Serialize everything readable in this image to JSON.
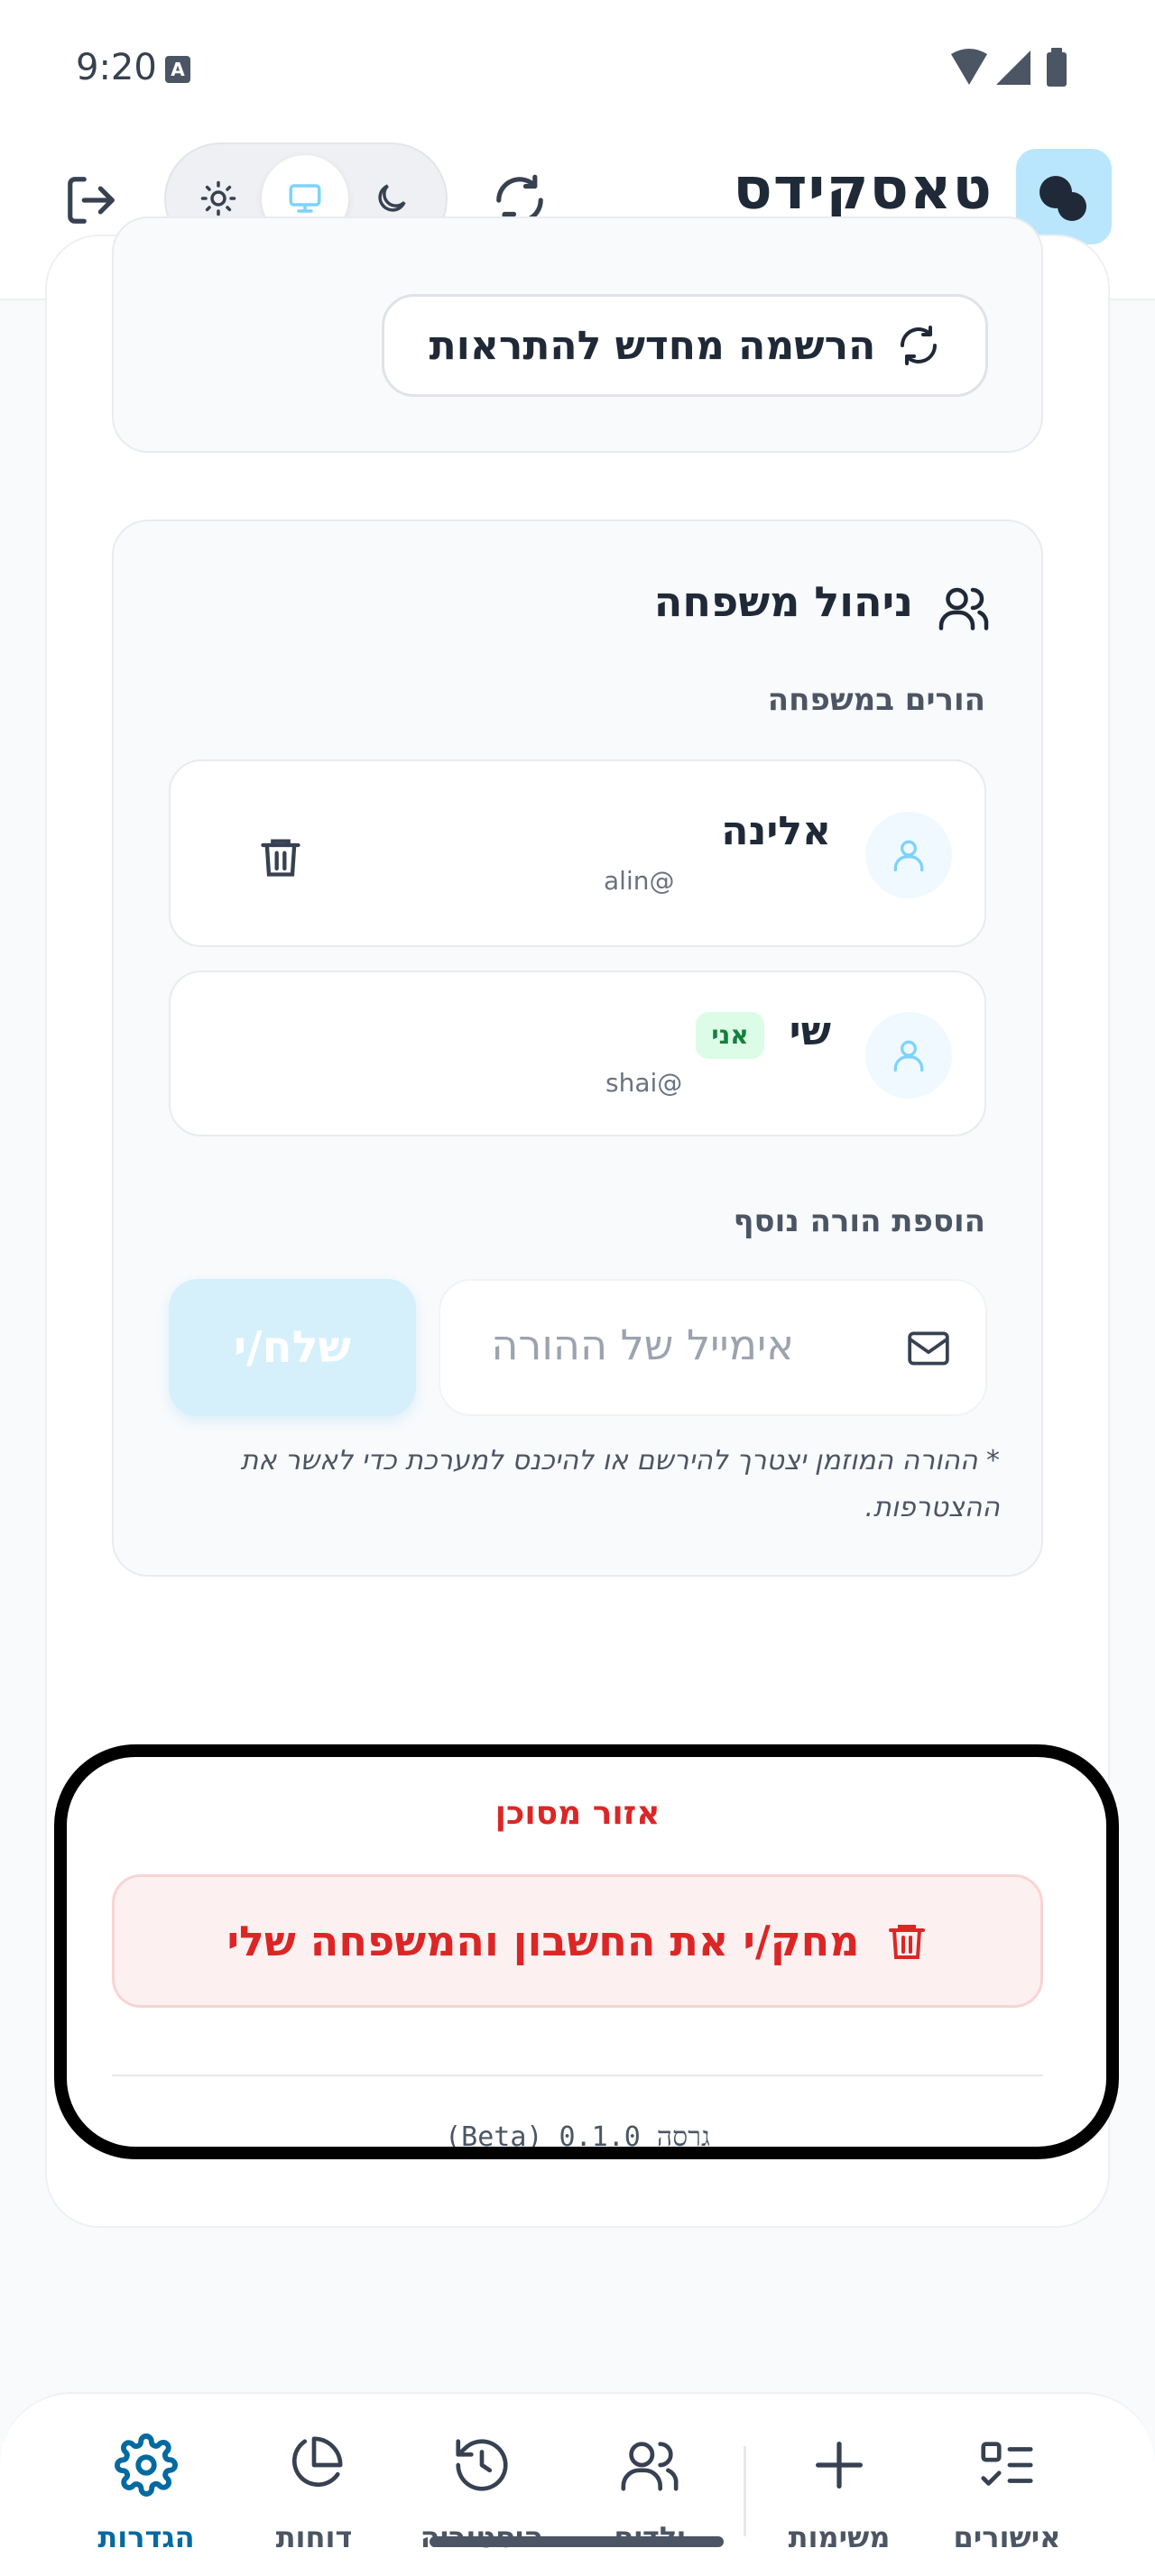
{
  "status_bar": {
    "time": "9:20",
    "notification_glyph": "A"
  },
  "header": {
    "title": "טאסקידס",
    "icons": [
      "logo-icon",
      "logout-icon",
      "moon-icon",
      "monitor-icon",
      "sun-icon",
      "refresh-icon"
    ],
    "theme_selected": "system"
  },
  "notifications": {
    "reregister_label": "הרשמה מחדש להתראות"
  },
  "family": {
    "title": "ניהול משפחה",
    "parents_label": "הורים במשפחה",
    "parents": [
      {
        "name": "אלינה",
        "email": "alin@",
        "is_me": false,
        "me_badge": ""
      },
      {
        "name": "שי",
        "email": "shai@",
        "is_me": true,
        "me_badge": "אני"
      }
    ],
    "add_parent_label": "הוספת הורה נוסף",
    "email_placeholder": "אימייל של ההורה",
    "send_label": "שלח/י",
    "note": "* ההורה המוזמן יצטרך להירשם או להיכנס למערכת כדי לאשר את ההצטרפות."
  },
  "danger_zone": {
    "title": "אזור מסוכן",
    "delete_label": "מחק/י את החשבון והמשפחה שלי"
  },
  "version": "גרסה 0.1.0 (Beta)",
  "bottom_nav": {
    "items": [
      {
        "id": "approvals",
        "label": "אישורים",
        "icon": "checklist-icon"
      },
      {
        "id": "tasks",
        "label": "משימות",
        "icon": "plus-icon"
      },
      {
        "id": "kids",
        "label": "ילדים",
        "icon": "users-icon"
      },
      {
        "id": "history",
        "label": "היסטוריה",
        "icon": "history-icon"
      },
      {
        "id": "reports",
        "label": "דוחות",
        "icon": "pie-chart-icon"
      },
      {
        "id": "settings",
        "label": "הגדרות",
        "icon": "gear-icon"
      }
    ],
    "active": "settings"
  },
  "colors": {
    "accent": "#0369a1",
    "danger": "#dc2626",
    "logo_bg": "#bae6fd"
  }
}
